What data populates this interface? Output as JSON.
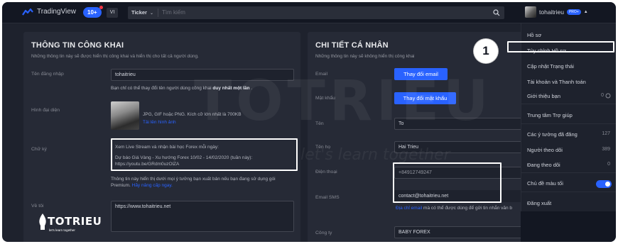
{
  "topbar": {
    "logo_text": "TradingView",
    "notif_badge": "10+",
    "lang": "VI",
    "search_select": "Ticker",
    "search_placeholder": "Tìm kiếm",
    "username": "tohaitrieu",
    "pro_badge": "PRO+"
  },
  "public_info": {
    "title": "THÔNG TIN CÔNG KHAI",
    "subtitle": "Những thông tin này sẽ được hiển thị công khai và hiển thị cho tất cả người dùng.",
    "username_label": "Tên đăng nhập",
    "username_value": "tohaitrieu",
    "username_note_prefix": "Bạn chỉ có thể thay đổi tên người dùng công khai",
    "username_note_bold": "duy nhất một lần",
    "username_note_suffix": ".",
    "avatar_label": "Hình đại diện",
    "avatar_hint": "JPG, GIF hoặc PNG. Kích cỡ lớn nhất là 700KB",
    "avatar_upload": "Tải lên hình ảnh",
    "signature_label": "Chữ ký",
    "signature_line1": "Xem Live Stream và nhận bài học Forex mỗi ngày:",
    "signature_line2": "Dự báo Giá Vàng - Xu hướng Forex 10/02 - 14/02/2020 (tuần này):",
    "signature_line3": "https://youtu.be/GRdm0uzOlZA",
    "signature_note": "Thông tin này hiển thị dưới mọi ý tưởng bạn xuất bản nếu bạn đang sử dụng gói",
    "signature_note2": "Premium.",
    "signature_note_link": "Hãy nâng cấp ngay.",
    "about_label": "Về tôi",
    "about_value": "https://www.tohaitrieu.net"
  },
  "personal": {
    "title": "CHI TIẾT CÁ NHÂN",
    "subtitle": "Những thông tin này sẽ không hiển thị công khai",
    "email_label": "Email",
    "email_button": "Thay đổi email",
    "password_label": "Mật khẩu",
    "password_button": "Thay đổi mật khẩu",
    "firstname_label": "Tên",
    "firstname_value": "To",
    "lastname_label": "Tên họ",
    "lastname_value": "Hai Trieu",
    "phone_label": "Điện thoại",
    "phone_value": "+84912749247",
    "sms_label": "Email SMS",
    "sms_value": "contact@tohaitrieu.net",
    "sms_note_link": "Địa chỉ email",
    "sms_note": "mà có thể được dùng để gửi tin nhắn văn b",
    "company_label": "Công ty",
    "company_value": "BABY FOREX"
  },
  "menu": {
    "profile": "Hồ sơ",
    "customize": "Tùy chỉnh Hồ sơ",
    "update_status": "Cập nhật Trạng thái",
    "account_billing": "Tài khoản và Thanh toán",
    "refer_friend": "Giới thiệu bạn",
    "refer_count": "0",
    "help_center": "Trung tâm Trợ giúp",
    "ideas_posted": "Các ý tưởng đã đăng",
    "ideas_count": "127",
    "followers": "Người theo dõi",
    "followers_count": "389",
    "following": "Đang theo dõi",
    "following_count": "0",
    "dark_theme": "Chủ đề màu tối",
    "logout": "Đăng xuất"
  },
  "annotation": {
    "step": "1"
  },
  "watermark": {
    "brand": "TOTRIEU",
    "slogan": "let's learn together",
    "big_text": "TOTRIEU",
    "big_slogan": "let's learn together"
  },
  "colors": {
    "accent": "#2962ff",
    "background": "#1e222d",
    "panel": "#262a36"
  }
}
